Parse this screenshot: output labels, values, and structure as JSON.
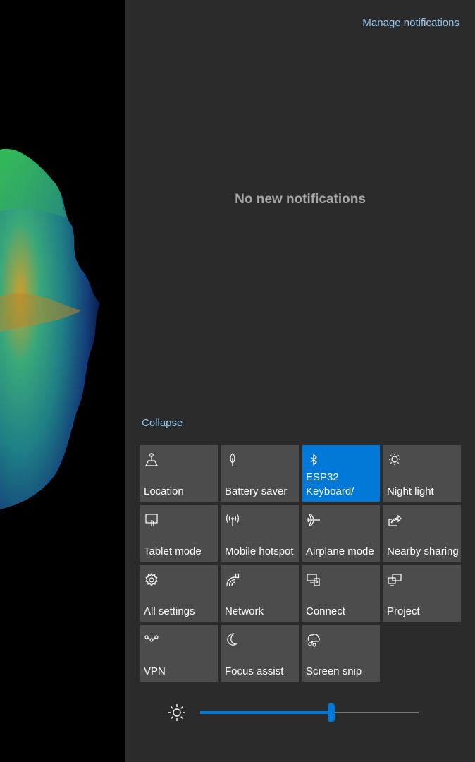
{
  "header": {
    "manage_label": "Manage notifications"
  },
  "notifications": {
    "empty_message": "No new notifications"
  },
  "quick_actions": {
    "collapse_label": "Collapse",
    "tiles": [
      {
        "label": "Location",
        "icon": "location-icon",
        "active": false
      },
      {
        "label": "Battery saver",
        "icon": "battery-saver-icon",
        "active": false
      },
      {
        "label": "ESP32 Keyboard/",
        "icon": "bluetooth-icon",
        "active": true
      },
      {
        "label": "Night light",
        "icon": "night-light-icon",
        "active": false
      },
      {
        "label": "Tablet mode",
        "icon": "tablet-mode-icon",
        "active": false
      },
      {
        "label": "Mobile hotspot",
        "icon": "hotspot-icon",
        "active": false
      },
      {
        "label": "Airplane mode",
        "icon": "airplane-icon",
        "active": false
      },
      {
        "label": "Nearby sharing",
        "icon": "share-icon",
        "active": false
      },
      {
        "label": "All settings",
        "icon": "gear-icon",
        "active": false
      },
      {
        "label": "Network",
        "icon": "network-icon",
        "active": false
      },
      {
        "label": "Connect",
        "icon": "connect-icon",
        "active": false
      },
      {
        "label": "Project",
        "icon": "project-icon",
        "active": false
      },
      {
        "label": "VPN",
        "icon": "vpn-icon",
        "active": false
      },
      {
        "label": "Focus assist",
        "icon": "moon-icon",
        "active": false
      },
      {
        "label": "Screen snip",
        "icon": "scissors-icon",
        "active": false
      }
    ]
  },
  "brightness": {
    "icon": "brightness-icon",
    "level": 0.6
  },
  "colors": {
    "accent": "#0078d7",
    "panel": "#2b2b2b",
    "tile": "#4c4c4c",
    "link": "#99c9ef"
  }
}
